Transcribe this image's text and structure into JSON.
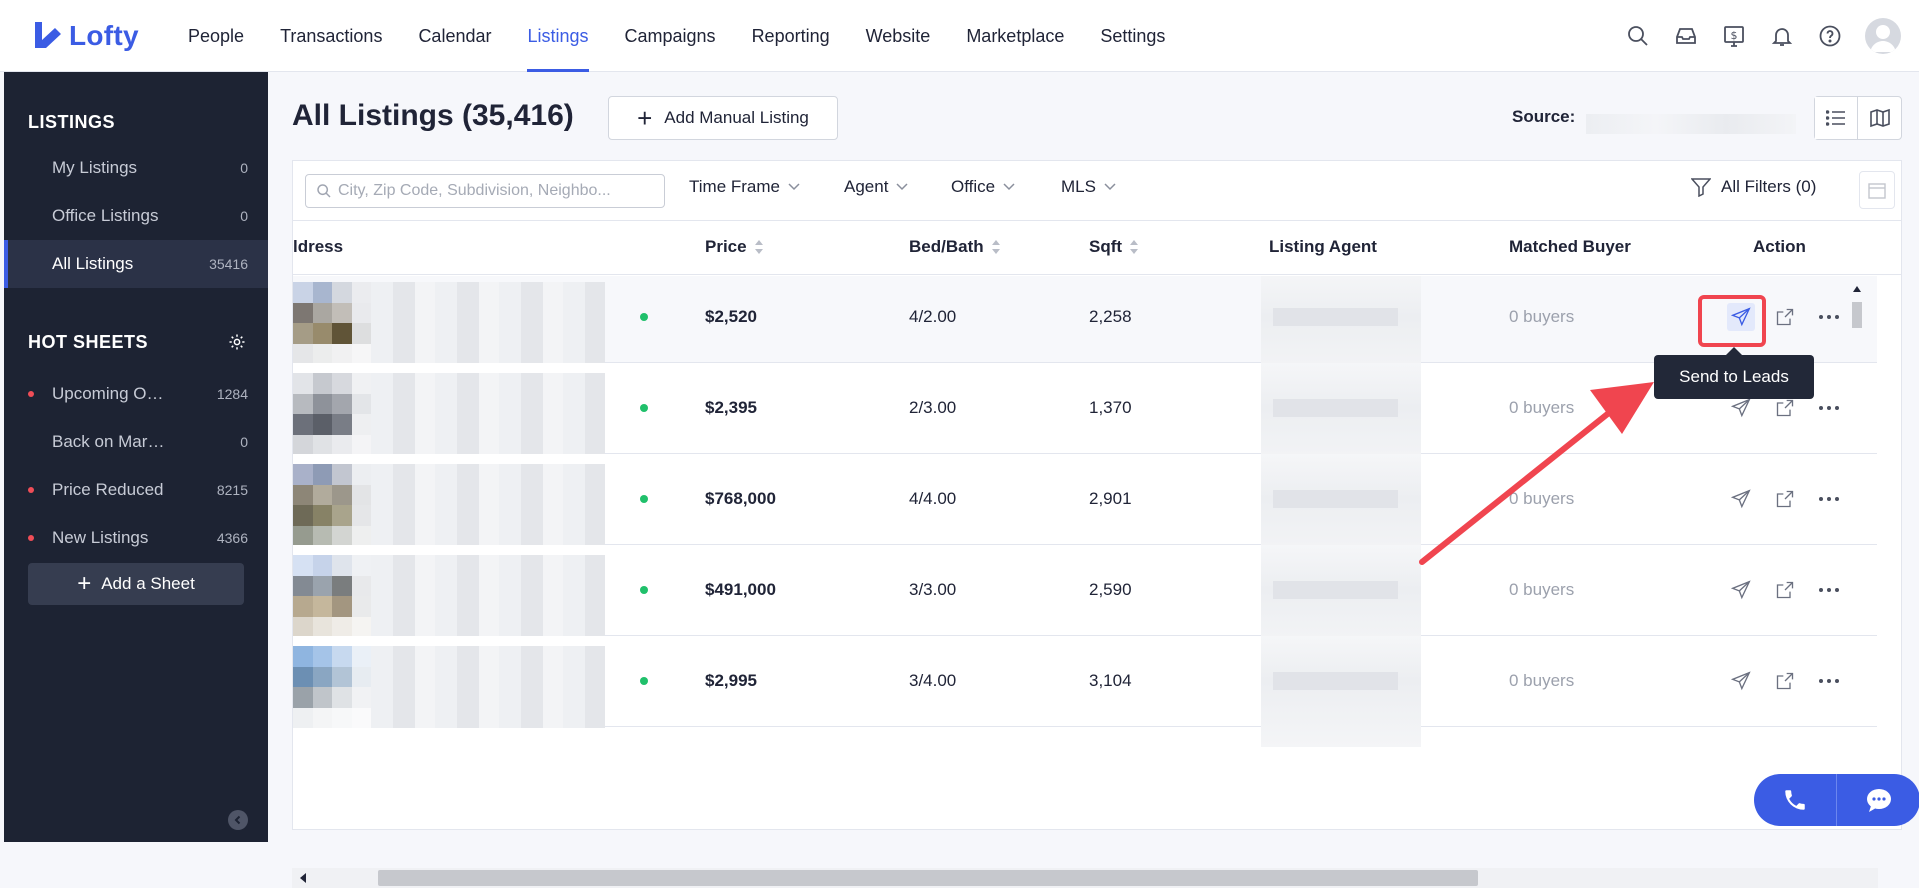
{
  "app": {
    "name": "Lofty",
    "brand_color": "#3b5ce4"
  },
  "nav": {
    "items": [
      {
        "label": "People"
      },
      {
        "label": "Transactions"
      },
      {
        "label": "Calendar"
      },
      {
        "label": "Listings",
        "active": true
      },
      {
        "label": "Campaigns"
      },
      {
        "label": "Reporting"
      },
      {
        "label": "Website"
      },
      {
        "label": "Marketplace"
      },
      {
        "label": "Settings"
      }
    ],
    "icons": [
      "search-icon",
      "inbox-icon",
      "dollar-icon",
      "bell-icon",
      "help-icon",
      "avatar"
    ]
  },
  "sidebar": {
    "listings_header": "LISTINGS",
    "listings": [
      {
        "label": "My Listings",
        "count": "0"
      },
      {
        "label": "Office Listings",
        "count": "0"
      },
      {
        "label": "All Listings",
        "count": "35416",
        "active": true
      }
    ],
    "hot_sheets_header": "HOT SHEETS",
    "hot_sheets": [
      {
        "label": "Upcoming Open ...",
        "count": "1284",
        "dot": true
      },
      {
        "label": "Back on Market",
        "count": "0",
        "dot": false
      },
      {
        "label": "Price Reduced",
        "count": "8215",
        "dot": true
      },
      {
        "label": "New Listings",
        "count": "4366",
        "dot": true
      }
    ],
    "add_sheet_label": "Add a Sheet"
  },
  "main": {
    "title": "All Listings (35,416)",
    "add_manual_label": "Add Manual Listing",
    "source_label": "Source:",
    "search": {
      "placeholder": "City, Zip Code, Subdivision, Neighbo...",
      "value": ""
    },
    "filters": [
      "Time Frame",
      "Agent",
      "Office",
      "MLS"
    ],
    "all_filters_label": "All Filters (0)",
    "columns": [
      "ldress",
      "Price",
      "Bed/Bath",
      "Sqft",
      "Listing Agent",
      "Matched Buyer",
      "Action"
    ],
    "rows": [
      {
        "price": "$2,520",
        "bedbath": "4/2.00",
        "sqft": "2,258",
        "buyers": "0 buyers"
      },
      {
        "price": "$2,395",
        "bedbath": "2/3.00",
        "sqft": "1,370",
        "buyers": "0 buyers"
      },
      {
        "price": "$768,000",
        "bedbath": "4/4.00",
        "sqft": "2,901",
        "buyers": "0 buyers"
      },
      {
        "price": "$491,000",
        "bedbath": "3/3.00",
        "sqft": "2,590",
        "buyers": "0 buyers"
      },
      {
        "price": "$2,995",
        "bedbath": "3/4.00",
        "sqft": "3,104",
        "buyers": "0 buyers"
      }
    ],
    "tooltip": "Send to Leads"
  },
  "colors": {
    "status_active": "#20c06b",
    "highlight_red": "#f0454f",
    "sidebar_bg": "#1d2333"
  }
}
